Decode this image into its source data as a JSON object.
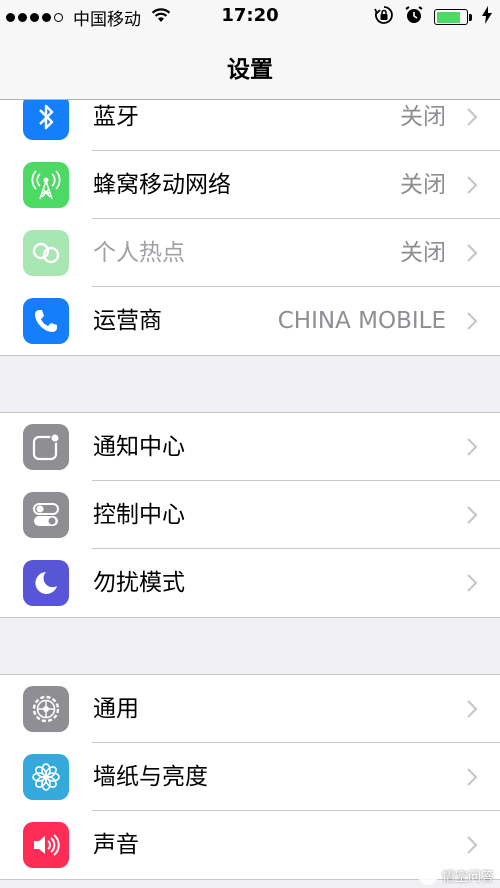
{
  "status_bar": {
    "carrier": "中国移动",
    "time": "17:20",
    "battery_level": 0.8,
    "battery_color": "#4cd964"
  },
  "nav": {
    "title": "设置"
  },
  "groups": [
    {
      "items": [
        {
          "label": "蓝牙",
          "value": "关闭",
          "icon": "bluetooth-icon",
          "color": "#147efb"
        },
        {
          "label": "蜂窝移动网络",
          "value": "关闭",
          "icon": "cellular-icon",
          "color": "#4cd964"
        },
        {
          "label": "个人热点",
          "value": "关闭",
          "icon": "hotspot-icon",
          "color": "#a8e6b4",
          "disabled": true
        },
        {
          "label": "运营商",
          "value": "CHINA MOBILE",
          "icon": "phone-icon",
          "color": "#147efb"
        }
      ]
    },
    {
      "items": [
        {
          "label": "通知中心",
          "icon": "notification-icon",
          "color": "#8e8e93"
        },
        {
          "label": "控制中心",
          "icon": "toggle-icon",
          "color": "#8e8e93"
        },
        {
          "label": "勿扰模式",
          "icon": "moon-icon",
          "color": "#5856d6"
        }
      ]
    },
    {
      "items": [
        {
          "label": "通用",
          "icon": "gear-icon",
          "color": "#8e8e93"
        },
        {
          "label": "墙纸与亮度",
          "icon": "flower-icon",
          "color": "#34aadc"
        },
        {
          "label": "声音",
          "icon": "speaker-icon",
          "color": "#ff2d55"
        }
      ]
    }
  ],
  "watermark": {
    "text": "悟空问答",
    "icon": "watermark-logo"
  }
}
